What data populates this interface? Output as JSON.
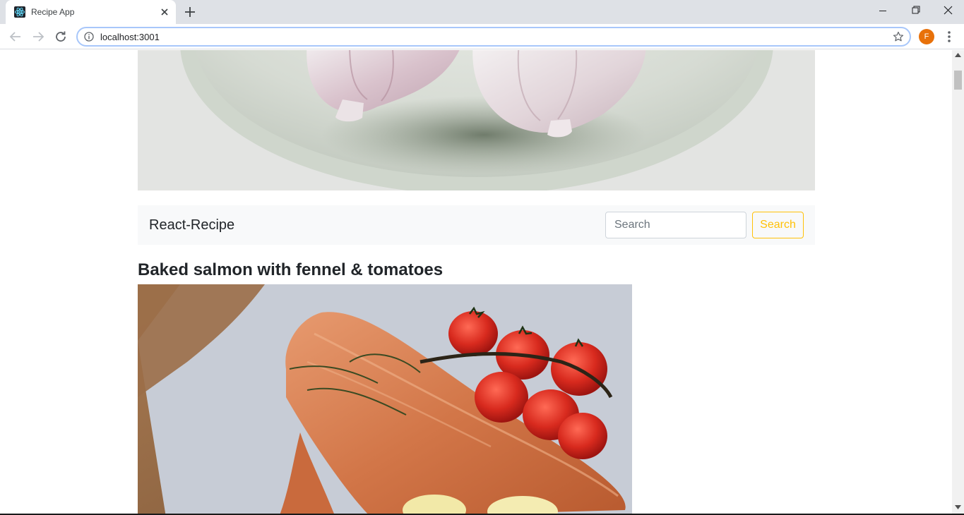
{
  "browser": {
    "tab_title": "Recipe App",
    "url": "localhost:3001",
    "profile_initial": "F",
    "icons": [
      "react-favicon-icon",
      "close-icon",
      "plus-icon",
      "minimize-icon",
      "restore-icon",
      "window-close-icon",
      "back-arrow-icon",
      "forward-arrow-icon",
      "reload-icon",
      "info-icon",
      "star-icon",
      "kebab-menu-icon"
    ],
    "colors": {
      "tabstrip": "#dee1e6",
      "omnibox_focus": "#a8c7fa",
      "profile": "#e8710a"
    }
  },
  "page": {
    "brand": "React-Recipe",
    "search": {
      "placeholder": "Search",
      "value": "",
      "button_label": "Search"
    },
    "recipes": [
      {
        "title": "Baked salmon with fennel & tomatoes",
        "image": "salmon-fillets-with-tomatoes"
      }
    ],
    "hero_image": "garlic-bulbs-on-plate",
    "colors": {
      "navbar_bg": "#f8f9fa",
      "accent": "#ffc107",
      "text": "#212529"
    }
  }
}
